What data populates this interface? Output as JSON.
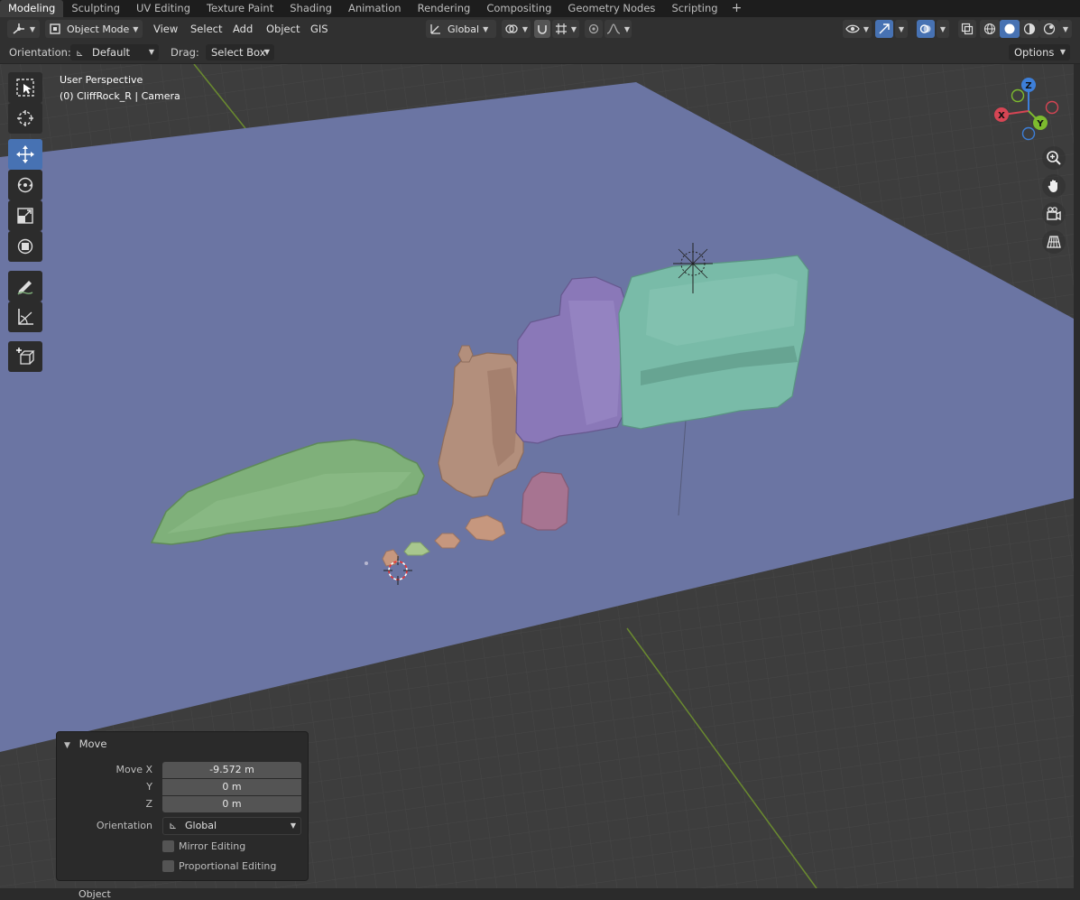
{
  "workspace_tabs": [
    "Modeling",
    "Sculpting",
    "UV Editing",
    "Texture Paint",
    "Shading",
    "Animation",
    "Rendering",
    "Compositing",
    "Geometry Nodes",
    "Scripting"
  ],
  "workspace_add": "+",
  "header": {
    "mode": "Object Mode",
    "menus": [
      "View",
      "Select",
      "Add",
      "Object",
      "GIS"
    ],
    "transform_orientation": "Global"
  },
  "tool_settings": {
    "orientation_label": "Orientation:",
    "orientation_value": "Default",
    "drag_label": "Drag:",
    "drag_value": "Select Box",
    "options_label": "Options"
  },
  "viewport": {
    "perspective": "User Perspective",
    "object_info": "(0) CliffRock_R | Camera"
  },
  "gizmo": {
    "x": "X",
    "y": "Y",
    "z": "Z"
  },
  "operator_panel": {
    "title": "Move",
    "move_x_label": "Move X",
    "move_x": "-9.572 m",
    "y_label": "Y",
    "y": "0 m",
    "z_label": "Z",
    "z": "0 m",
    "orientation_label": "Orientation",
    "orientation_value": "Global",
    "mirror_label": "Mirror Editing",
    "proportional_label": "Proportional Editing"
  },
  "status_bar": {
    "text": "Object"
  },
  "colors": {
    "accent": "#4772b3",
    "ground_plane": "#6b75a3",
    "green_rock": "#7fb07a",
    "tan_rock": "#b38f7c",
    "purple_rock": "#8a78b8",
    "teal_rock": "#79bba8",
    "pink_rock": "#a77491",
    "axis_red": "#d64554",
    "axis_green": "#7dbb2e",
    "axis_blue": "#3d7fd9"
  }
}
